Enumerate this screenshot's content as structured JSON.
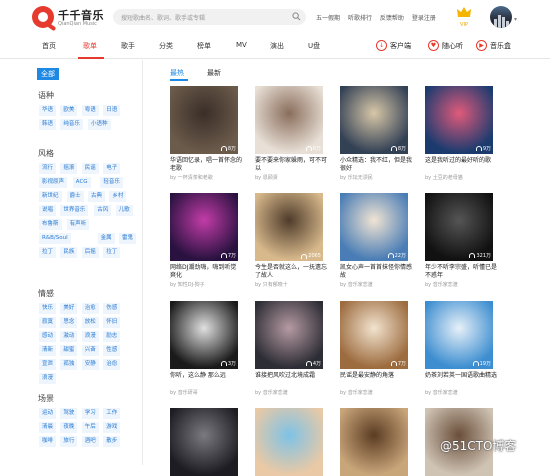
{
  "app": {
    "name": "千千音乐",
    "name_en": "QianQian Music"
  },
  "search": {
    "placeholder": "搜短歌曲名、歌词、歌手或专辑"
  },
  "top_links": [
    "五一假期",
    "听歌排行",
    "反馈帮助",
    "登录注册"
  ],
  "vip": {
    "label": "VIP"
  },
  "nav": {
    "items": [
      "首页",
      "歌单",
      "歌手",
      "分类",
      "榜单",
      "MV",
      "演出",
      "U盘"
    ],
    "active_index": 1,
    "right": [
      {
        "label": "客户端",
        "icon": "download-icon"
      },
      {
        "label": "随心听",
        "icon": "radio-icon"
      },
      {
        "label": "音乐盒",
        "icon": "music-box-icon"
      }
    ]
  },
  "sidebar": {
    "all_label": "全部",
    "categories": [
      {
        "title": "语种",
        "tags": [
          "华语",
          "欧美",
          "粤语",
          "日语",
          "韩语",
          "纯音乐",
          "小语种"
        ]
      },
      {
        "title": "风格",
        "tags": [
          "流行",
          "摇滚",
          "民谣",
          "电子",
          "影视原声",
          "ACG",
          "轻音乐",
          "新世纪",
          "爵士",
          "古典",
          "乡村",
          "说唱",
          "世界音乐",
          "古风",
          "儿歌",
          "布鲁斯",
          "有声听",
          "R&B/Soul",
          "金属",
          "雷鬼",
          "拉丁",
          "民族",
          "后摇",
          "拉丁"
        ]
      },
      {
        "title": "情感",
        "tags": [
          "快乐",
          "美好",
          "治愈",
          "伤感",
          "寂寞",
          "思念",
          "放松",
          "怀旧",
          "感动",
          "激动",
          "浪漫",
          "励志",
          "清新",
          "甜蜜",
          "兴奋",
          "性感",
          "宣泄",
          "孤独",
          "安静",
          "治愈",
          "浪漫"
        ]
      },
      {
        "title": "场景",
        "tags": [
          "运动",
          "驾驶",
          "学习",
          "工作",
          "清晨",
          "夜晚",
          "午后",
          "游戏",
          "咖啡",
          "旅行",
          "酒吧",
          "散步"
        ]
      }
    ]
  },
  "tabs": {
    "items": [
      "最热",
      "最新"
    ],
    "active_index": 0
  },
  "playlists": [
    {
      "title": "华语回忆录，唱一首怀念的老歌",
      "author": "by 一杯清茶和老歌",
      "plays": "8万"
    },
    {
      "title": "要不要来你家躲雨，可不可以",
      "author": "by 恩顾贤",
      "plays": "6万"
    },
    {
      "title": "小众精选：我不红，但是我很好",
      "author": "by 乐坛无漂民",
      "plays": "8万"
    },
    {
      "title": "这是我听过的最好听的歌",
      "author": "by 土豆的老母猫",
      "plays": "9万"
    },
    {
      "title": "网络DJ潮劲嗨，嗨到听觉爽化",
      "author": "by 知性DJ-狗子",
      "plays": "7万"
    },
    {
      "title": "今生是否就这么，一抚遗忘了故人",
      "author": "by 只有郁晓十",
      "plays": "2065"
    },
    {
      "title": "凯女心声一首首抹怪你情感故",
      "author": "by 音乐家恋渡",
      "plays": "22万"
    },
    {
      "title": "年少不听李宗盛，听懂已是不惑年",
      "author": "by 音乐家恋渡",
      "plays": "321万"
    },
    {
      "title": "你听，这么静 那么远",
      "author": "by 音乐研哥",
      "plays": "3万"
    },
    {
      "title": "谁接把风吹过北境成霜",
      "author": "by 音乐家恋渡",
      "plays": "4万"
    },
    {
      "title": "民谣是最安静的角落",
      "author": "by 音乐家恋渡",
      "plays": "7万"
    },
    {
      "title": "奶茶刘若英一国语歌曲精选",
      "author": "by 音乐家恋渡",
      "plays": "19万"
    },
    {
      "title": "",
      "author": "",
      "plays": ""
    },
    {
      "title": "",
      "author": "",
      "plays": ""
    },
    {
      "title": "",
      "author": "",
      "plays": ""
    },
    {
      "title": "",
      "author": "",
      "plays": ""
    }
  ],
  "watermark": "@51CTO博客",
  "colors": {
    "accent": "#e63a2e",
    "link": "#1e88e5",
    "tag_bg": "#eef5fc",
    "tag_text": "#2a7bd4"
  }
}
